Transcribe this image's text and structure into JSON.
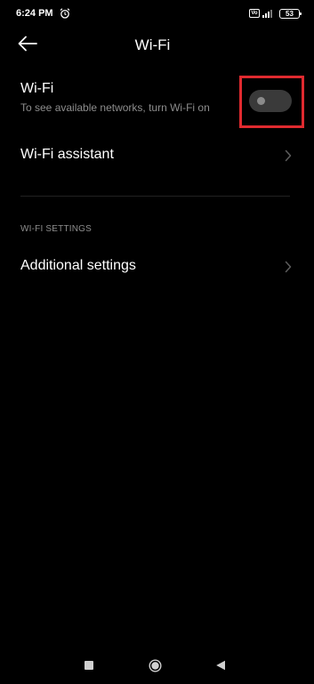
{
  "status_bar": {
    "time": "6:24 PM",
    "alarm_icon": "alarm-clock-icon",
    "volte_label": "Vo",
    "battery_level": "53"
  },
  "header": {
    "back_icon": "arrow-left-icon",
    "title": "Wi-Fi"
  },
  "wifi_toggle_row": {
    "title": "Wi-Fi",
    "subtitle": "To see available networks, turn Wi-Fi on",
    "toggle_on": false
  },
  "wifi_assistant_row": {
    "title": "Wi-Fi assistant",
    "icon": "chevron-right-icon"
  },
  "section": {
    "header": "WI-FI SETTINGS"
  },
  "additional_settings_row": {
    "title": "Additional settings",
    "icon": "chevron-right-icon"
  },
  "nav_bar": {
    "recents_icon": "square-icon",
    "home_icon": "circle-icon",
    "back_icon": "triangle-back-icon"
  },
  "colors": {
    "background": "#000000",
    "highlight_box": "#e02a2f",
    "toggle_track": "#3a3a3a",
    "secondary_text": "#8d8d8d"
  }
}
